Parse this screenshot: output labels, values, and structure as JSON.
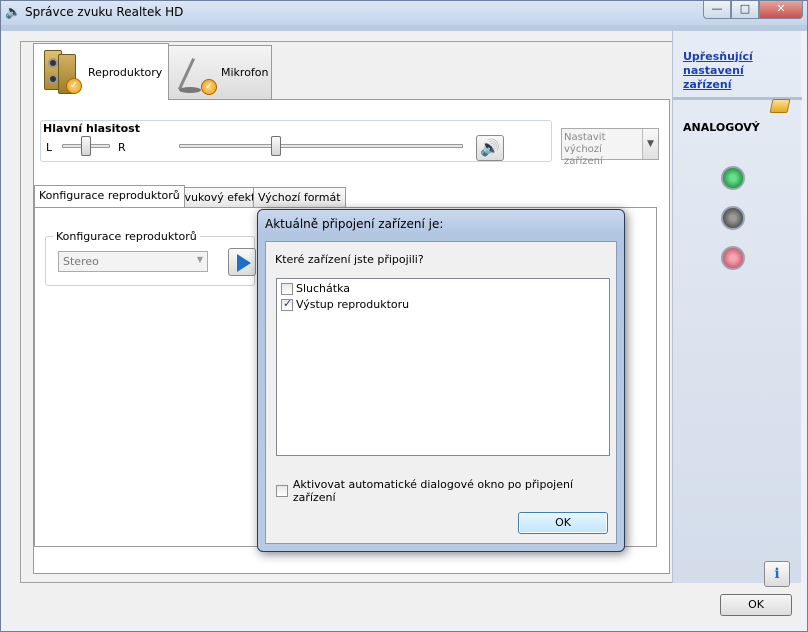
{
  "window": {
    "title": "Správce zvuku Realtek HD",
    "icon": "speaker-icon",
    "controls": {
      "minimize": "—",
      "maximize": "□",
      "close": "✕"
    }
  },
  "tabs": [
    {
      "label": "Reproduktory",
      "icon": "speakers-icon",
      "active": true
    },
    {
      "label": "Mikrofon",
      "icon": "microphone-icon",
      "active": false
    }
  ],
  "volume": {
    "label": "Hlavní hlasitost",
    "left": "L",
    "right": "R",
    "default_device": "Nastavit výchozí zařízení"
  },
  "subtabs": [
    {
      "label": "Konfigurace reproduktorů",
      "active": true
    },
    {
      "label": "Zvukový efekt",
      "active": false
    },
    {
      "label": "Výchozí formát",
      "active": false
    }
  ],
  "config": {
    "group_label": "Konfigurace reproduktorů",
    "selected": "Stereo"
  },
  "right_pane": {
    "link": "Upřesňující nastavení zařízení",
    "analog": "ANALOGOVÝ",
    "jack_colors": [
      "#2a9a4a",
      "#555555",
      "#d06070"
    ]
  },
  "footer": {
    "ok": "OK",
    "info": "i"
  },
  "dialog": {
    "title": "Aktuálně připojení zařízení je:",
    "question": "Které zařízení jste připojili?",
    "items": [
      {
        "label": "Sluchátka",
        "checked": false
      },
      {
        "label": "Výstup reproduktoru",
        "checked": true
      }
    ],
    "auto_popup": "Aktivovat automatické dialogové okno po připojení zařízení",
    "auto_checked": false,
    "ok": "OK"
  }
}
